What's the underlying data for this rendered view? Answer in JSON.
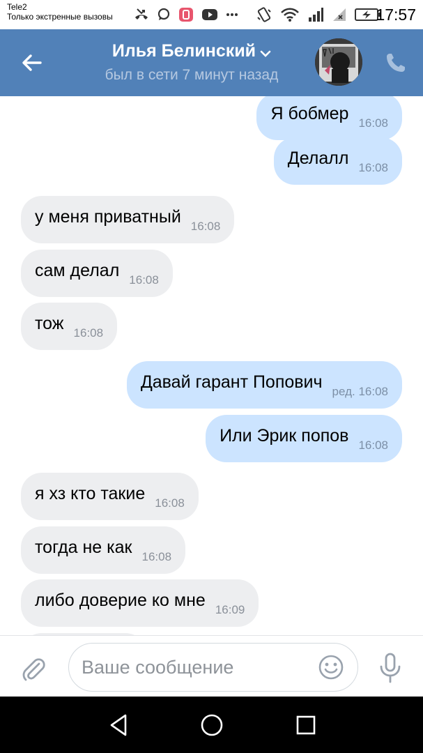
{
  "status_bar": {
    "carrier": "Tele2",
    "network_note": "Только экстренные вызовы",
    "time": "17:57",
    "icons": [
      "missed-call-icon",
      "chat-bubble-icon",
      "app-notification-icon",
      "youtube-icon",
      "more-dots-icon",
      "vibrate-icon",
      "wifi-icon",
      "signal-icon",
      "no-sim-signal-icon",
      "battery-charging-icon"
    ]
  },
  "header": {
    "name": "Илья Белинский",
    "status": "был в сети 7 минут назад",
    "icons": [
      "back-arrow-icon",
      "chevron-down-icon",
      "phone-icon"
    ]
  },
  "messages": [
    {
      "dir": "out",
      "text": "Я бобмер",
      "time": "16:08"
    },
    {
      "dir": "out",
      "text": "Делалл",
      "time": "16:08"
    },
    {
      "dir": "in",
      "text": "у меня приватный",
      "time": "16:08"
    },
    {
      "dir": "in",
      "text": "сам делал",
      "time": "16:08"
    },
    {
      "dir": "in",
      "text": "тож",
      "time": "16:08"
    },
    {
      "dir": "out",
      "text": "Давай гарант Попович",
      "time": "ред. 16:08"
    },
    {
      "dir": "out",
      "text": "Или Эрик попов",
      "time": "16:08"
    },
    {
      "dir": "in",
      "text": "я хз кто такие",
      "time": "16:08"
    },
    {
      "dir": "in",
      "text": "тогда не как",
      "time": "16:08"
    },
    {
      "dir": "in",
      "text": "либо доверие ко мне",
      "time": "16:09"
    }
  ],
  "input": {
    "placeholder": "Ваше сообщение",
    "value": "",
    "icons": [
      "paperclip-icon",
      "emoji-icon",
      "microphone-icon"
    ]
  },
  "nav": {
    "icons": [
      "back-triangle-icon",
      "home-circle-icon",
      "recents-square-icon"
    ]
  },
  "colors": {
    "header_bg": "#5181b8",
    "incoming_bubble": "#edeef0",
    "outgoing_bubble": "#cce4ff",
    "status_text": "#b6c9e1"
  }
}
